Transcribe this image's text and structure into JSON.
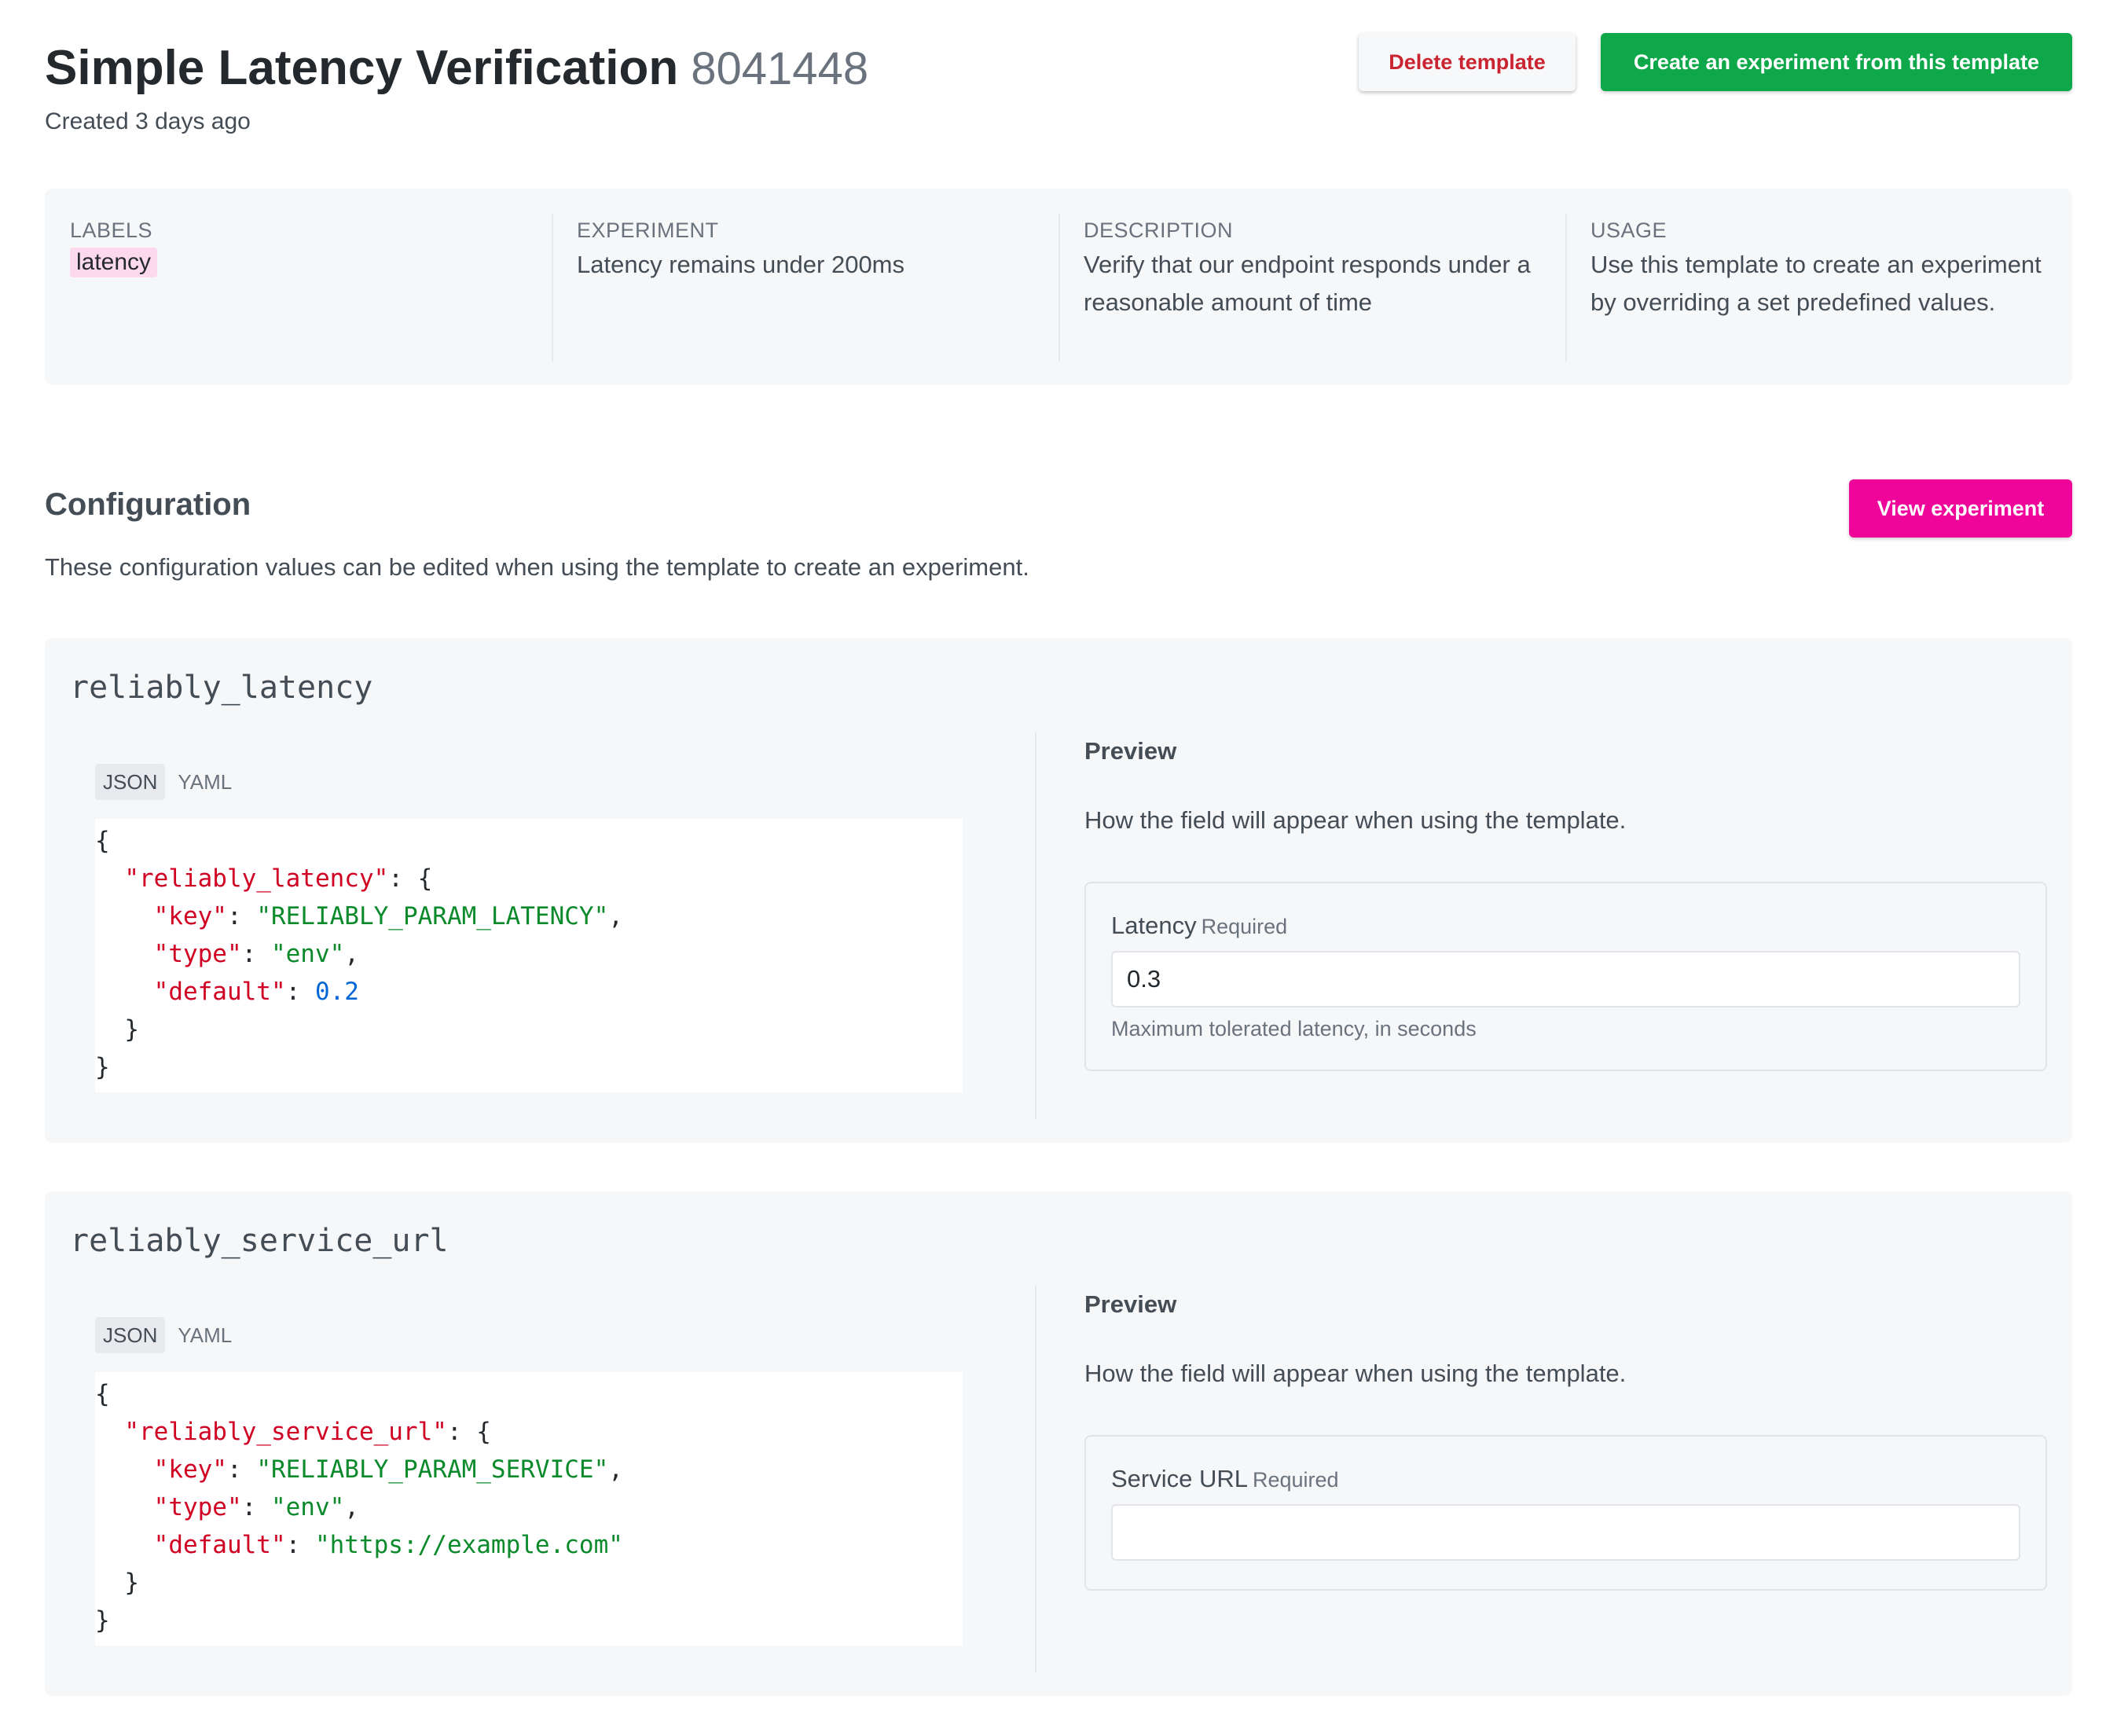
{
  "header": {
    "title": "Simple Latency Verification",
    "template_id": "8041448",
    "created": "Created 3 days ago",
    "delete_label": "Delete template",
    "create_label": "Create an experiment from this template"
  },
  "info": {
    "labels": {
      "heading": "LABELS",
      "items": [
        "latency"
      ]
    },
    "experiment": {
      "heading": "EXPERIMENT",
      "value": "Latency remains under 200ms"
    },
    "description": {
      "heading": "DESCRIPTION",
      "value": "Verify that our endpoint responds under a reasonable amount of time"
    },
    "usage": {
      "heading": "USAGE",
      "value": "Use this template to create an experiment by overriding a set predefined values."
    }
  },
  "configuration": {
    "title": "Configuration",
    "description": "These configuration values can be edited when using the template to create an experiment.",
    "view_label": "View experiment"
  },
  "params": [
    {
      "name": "reliably_latency",
      "tabs": [
        "JSON",
        "YAML"
      ],
      "active_tab": "JSON",
      "code": {
        "outer_key": "\"reliably_latency\"",
        "key_key": "\"key\"",
        "key_value": "\"RELIABLY_PARAM_LATENCY\"",
        "type_key": "\"type\"",
        "type_value": "\"env\"",
        "default_key": "\"default\"",
        "default_value": "0.2"
      },
      "preview": {
        "title": "Preview",
        "description": "How the field will appear when using the template.",
        "field_label": "Latency",
        "required": "Required",
        "value": "0.3",
        "help": "Maximum tolerated latency, in seconds"
      }
    },
    {
      "name": "reliably_service_url",
      "tabs": [
        "JSON",
        "YAML"
      ],
      "active_tab": "JSON",
      "code": {
        "outer_key": "\"reliably_service_url\"",
        "key_key": "\"key\"",
        "key_value": "\"RELIABLY_PARAM_SERVICE\"",
        "type_key": "\"type\"",
        "type_value": "\"env\"",
        "default_key": "\"default\"",
        "default_value": "\"https://example.com\""
      },
      "preview": {
        "title": "Preview",
        "description": "How the field will appear when using the template.",
        "field_label": "Service URL",
        "required": "Required",
        "value": ""
      }
    }
  ],
  "colors": {
    "create_button": "#0ea84a",
    "delete_text": "#cb2431",
    "view_button": "#f0059a",
    "label_badge": "#fdd9ee",
    "json_key": "#d00023",
    "json_string": "#0b8a2b",
    "json_number": "#0366d6"
  }
}
